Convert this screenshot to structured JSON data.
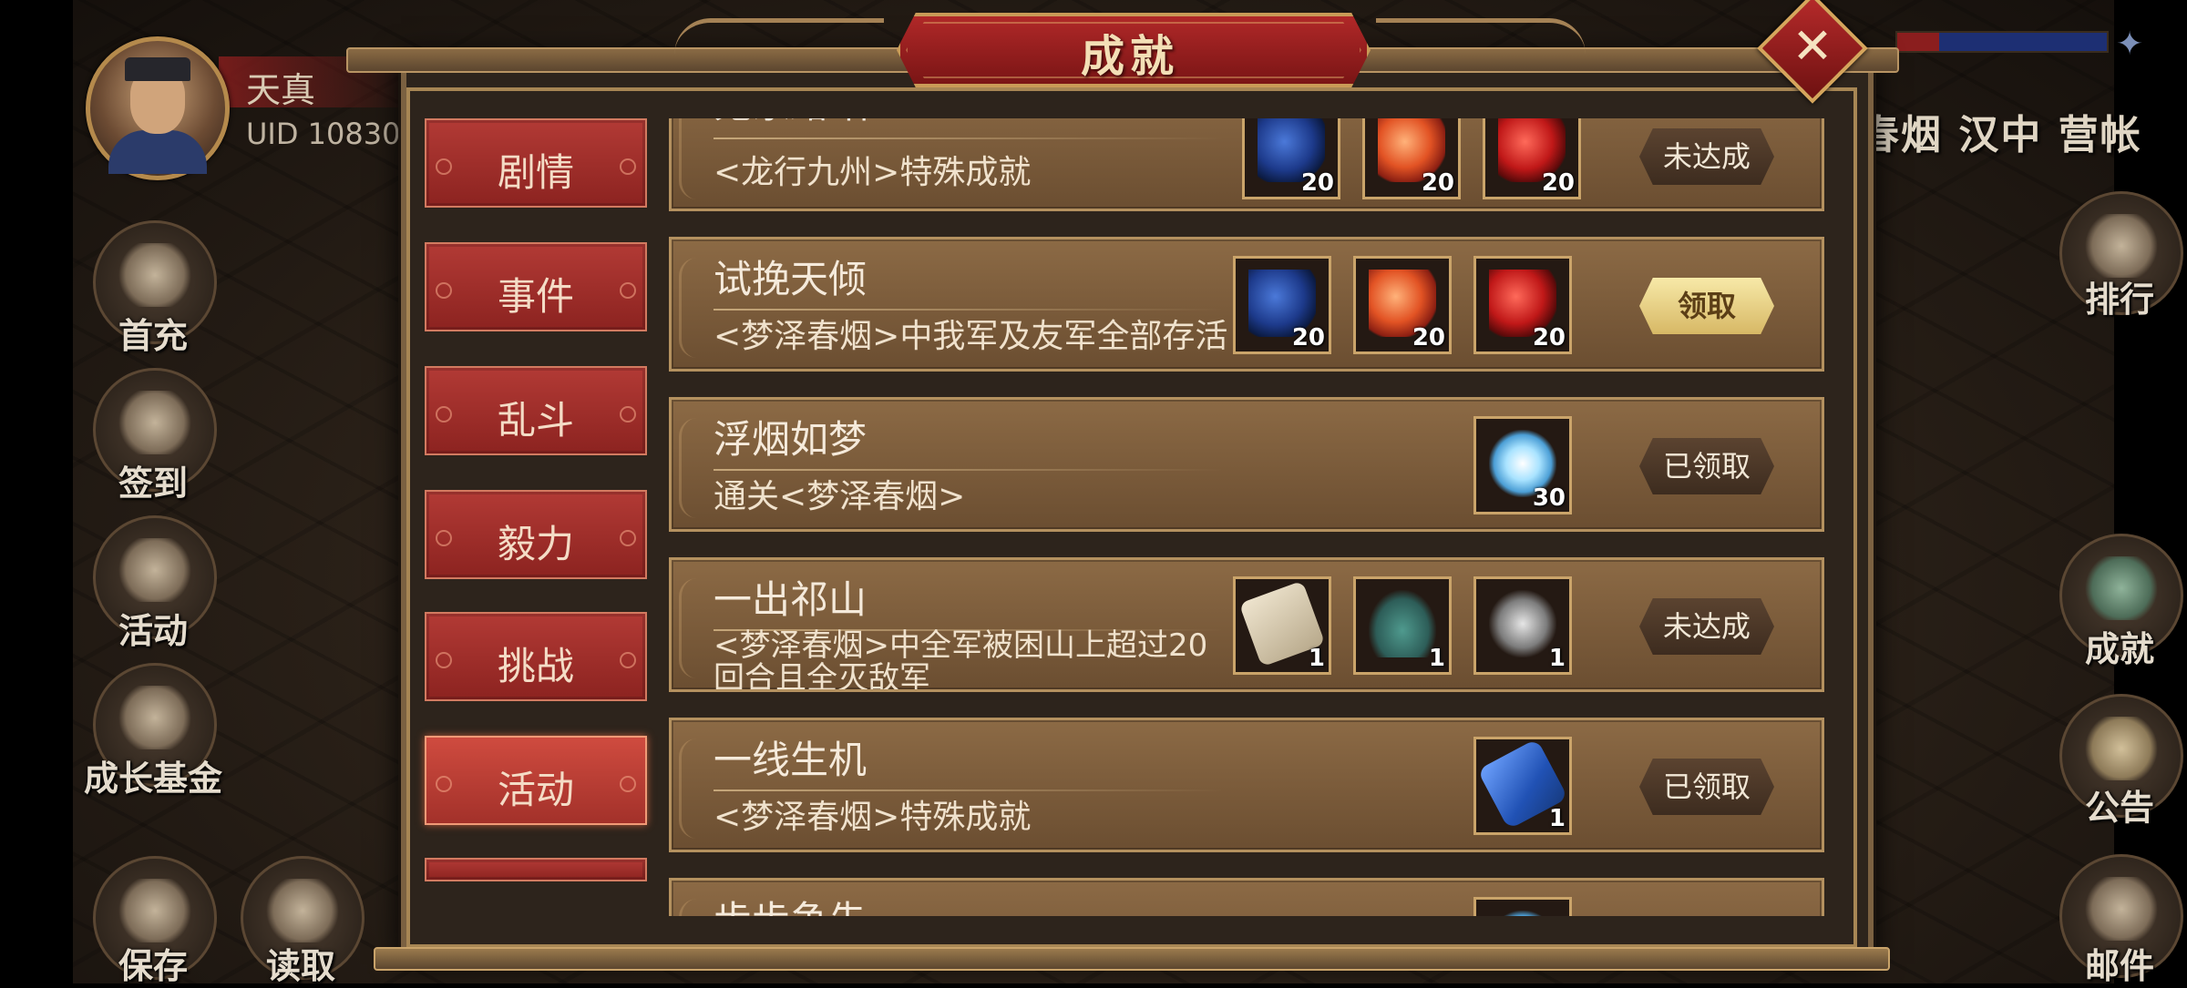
{
  "player": {
    "name": "天真",
    "uid": "UID  10830"
  },
  "left_menu": [
    {
      "label": "首充",
      "icon": "gift-bag-icon"
    },
    {
      "label": "签到",
      "icon": "signin-book-icon"
    },
    {
      "label": "活动",
      "icon": "event-treasure-icon"
    },
    {
      "label": "成长基金",
      "icon": "growth-plant-icon"
    }
  ],
  "bottom_left": [
    {
      "label": "保存",
      "icon": "save-icon"
    },
    {
      "label": "读取",
      "icon": "load-icon"
    }
  ],
  "right_menu": [
    {
      "label": "排行",
      "icon": "ranking-plaque-icon"
    },
    {
      "label": "成就",
      "icon": "achievement-chest-icon"
    },
    {
      "label": "公告",
      "icon": "notice-scroll-icon"
    },
    {
      "label": "邮件",
      "icon": "mail-icon"
    }
  ],
  "top_right_text": "春烟 汉中 营帐",
  "modal": {
    "title": "成就",
    "tabs": [
      {
        "label": "剧情",
        "active": false
      },
      {
        "label": "事件",
        "active": false
      },
      {
        "label": "乱斗",
        "active": false
      },
      {
        "label": "毅力",
        "active": false
      },
      {
        "label": "挑战",
        "active": false
      },
      {
        "label": "活动",
        "active": true
      }
    ],
    "achievements": [
      {
        "title": "鬼家路 作",
        "desc": "<龙行九州>特殊成就",
        "rewards": [
          {
            "icon": "blue-plum-icon",
            "qty": "20"
          },
          {
            "icon": "peach-icon",
            "qty": "20"
          },
          {
            "icon": "red-heart-icon",
            "qty": "20"
          }
        ],
        "status": "未达成"
      },
      {
        "title": "试挽天倾",
        "desc": "<梦泽春烟>中我军及友军全部存活",
        "rewards": [
          {
            "icon": "blue-plum-icon",
            "qty": "20"
          },
          {
            "icon": "peach-icon",
            "qty": "20"
          },
          {
            "icon": "red-heart-icon",
            "qty": "20"
          }
        ],
        "status": "领取"
      },
      {
        "title": "浮烟如梦",
        "desc": "通关<梦泽春烟>",
        "rewards": [
          {
            "icon": "ice-crystal-icon",
            "qty": "30"
          }
        ],
        "status": "已领取"
      },
      {
        "title": "一出祁山",
        "desc": "<梦泽春烟>中全军被困山上超过20回合且全灭敌军",
        "rewards": [
          {
            "icon": "token-tablet-icon",
            "qty": "1"
          },
          {
            "icon": "helmet-icon",
            "qty": "1"
          },
          {
            "icon": "armor-icon",
            "qty": "1"
          }
        ],
        "status": "未达成"
      },
      {
        "title": "一线生机",
        "desc": "<梦泽春烟>特殊成就",
        "rewards": [
          {
            "icon": "blue-scroll-icon",
            "qty": "1"
          }
        ],
        "status": "已领取"
      },
      {
        "title": "步步争先",
        "desc": "",
        "rewards": [
          {
            "icon": "ice-crystal-icon",
            "qty": ""
          }
        ],
        "status": ""
      }
    ]
  },
  "colors": {
    "tab_red": "#b23a35",
    "card_brown": "#7a5a3a",
    "gold_border": "#caa46a",
    "claim_gold": "#e6cf82"
  }
}
